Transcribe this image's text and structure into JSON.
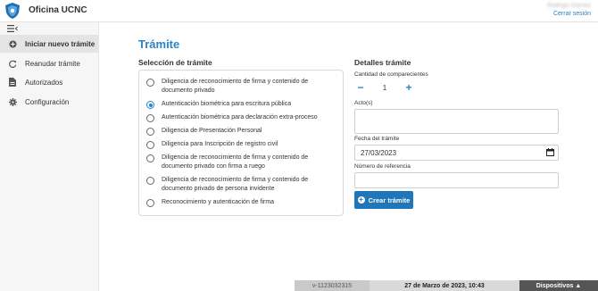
{
  "app": {
    "title": "Oficina UCNC"
  },
  "user": {
    "name": "Rodrigo Gómez",
    "logout_label": "Cerrar sesión"
  },
  "sidebar": {
    "items": [
      {
        "label": "Iniciar nuevo trámite",
        "icon": "plus-circle-icon"
      },
      {
        "label": "Reanudar trámite",
        "icon": "refresh-icon"
      },
      {
        "label": "Autorizados",
        "icon": "document-icon"
      },
      {
        "label": "Configuración",
        "icon": "gear-icon"
      }
    ]
  },
  "main": {
    "title": "Trámite",
    "selection": {
      "title": "Selección de trámite",
      "selected_index": 1,
      "options": [
        "Diligencia de reconocimiento de firma y contenido de documento privado",
        "Autenticación biométrica para escritura pública",
        "Autenticación biométrica para declaración extra-proceso",
        "Diligencia de Presentación Personal",
        "Diligencia para Inscripción de registro civil",
        "Diligencia de reconocimiento de firma y contenido de documento privado con firma a ruego",
        "Diligencia de reconocimiento de firma y contenido de documento privado de persona invidente",
        "Reconocimiento y autenticación de firma"
      ]
    },
    "details": {
      "title": "Detalles trámite",
      "count_label": "Cantidad de comparecientes",
      "count_value": "1",
      "minus_label": "−",
      "plus_label": "+",
      "acts_label": "Acto(s)",
      "acts_value": "",
      "date_label": "Fecha del trámite",
      "date_value": "27/03/2023",
      "reference_label": "Número de referencia",
      "reference_value": "",
      "create_label": "Crear trámite"
    }
  },
  "footer": {
    "version": "v-1123032315",
    "datetime": "27 de Marzo de 2023, 10:43",
    "devices_label": "Dispositivos ▲"
  },
  "colors": {
    "accent": "#2a84c6",
    "button": "#1f76b8",
    "footer_dark": "#555555"
  }
}
